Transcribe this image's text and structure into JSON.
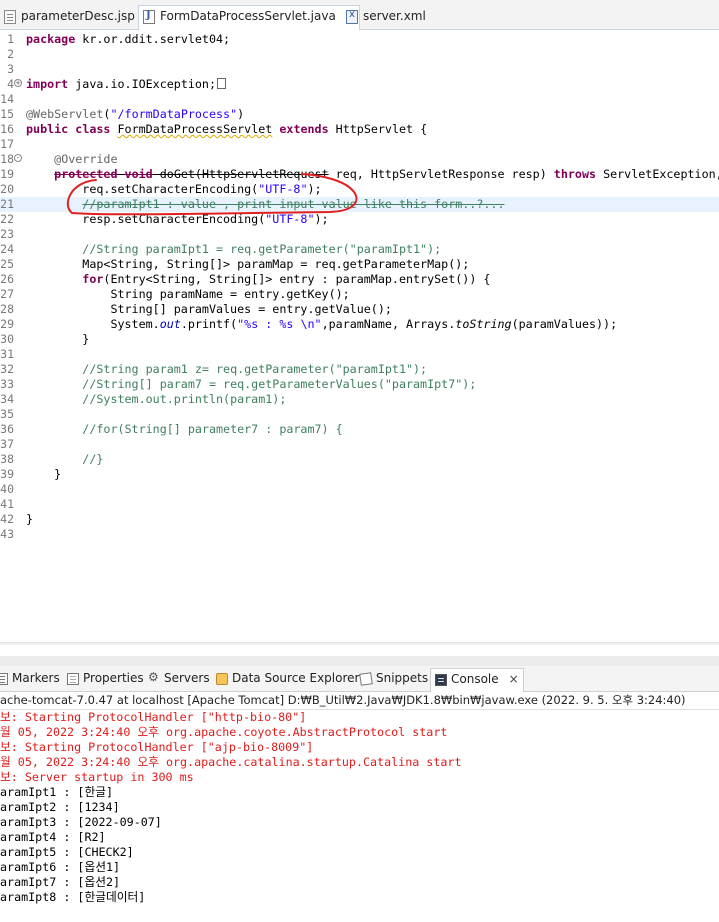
{
  "editor_tabs": [
    {
      "label": "parameterDesc.jsp",
      "icon": "jsp-file-icon",
      "active": false
    },
    {
      "label": "FormDataProcessServlet.java",
      "icon": "java-file-icon",
      "active": true,
      "close": "×"
    },
    {
      "label": "server.xml",
      "icon": "xml-file-icon",
      "active": false
    }
  ],
  "code": {
    "lines": [
      {
        "n": "1",
        "spans": [
          {
            "t": "package",
            "c": "kw"
          },
          {
            "t": " kr.or.ddit.servlet04;"
          }
        ]
      },
      {
        "n": "2",
        "spans": []
      },
      {
        "n": "3",
        "spans": []
      },
      {
        "n": "4",
        "fold": "+",
        "spans": [
          {
            "t": "import",
            "c": "kw"
          },
          {
            "t": " java.io.IOException;"
          }
        ],
        "collapsed": true
      },
      {
        "n": "14",
        "spans": []
      },
      {
        "n": "15",
        "spans": [
          {
            "t": "@WebServlet",
            "c": "ann"
          },
          {
            "t": "("
          },
          {
            "t": "\"/formDataProcess\"",
            "c": "str"
          },
          {
            "t": ")"
          }
        ]
      },
      {
        "n": "16",
        "spans": [
          {
            "t": "public",
            "c": "kw"
          },
          {
            "t": " "
          },
          {
            "t": "class",
            "c": "kw"
          },
          {
            "t": " "
          },
          {
            "t": "FormDataProcessServlet",
            "c": "warn"
          },
          {
            "t": " "
          },
          {
            "t": "extends",
            "c": "kw"
          },
          {
            "t": " HttpServlet {"
          }
        ]
      },
      {
        "n": "17",
        "spans": []
      },
      {
        "n": "18",
        "fold": "-",
        "spans": [
          {
            "t": "    "
          },
          {
            "t": "@Override",
            "c": "ann"
          }
        ]
      },
      {
        "n": "19",
        "spans": [
          {
            "t": "    "
          },
          {
            "t": "protected",
            "c": "kw strike"
          },
          {
            "t": " ",
            "c": "strike"
          },
          {
            "t": "void",
            "c": "kw strike"
          },
          {
            "t": " doGet(HttpServletRequest",
            "c": "strike"
          },
          {
            "t": " req, HttpServletResponse resp) "
          },
          {
            "t": "throws",
            "c": "kw"
          },
          {
            "t": " ServletException, IOExceptio"
          }
        ]
      },
      {
        "n": "20",
        "spans": [
          {
            "t": "        req.setCharacterEncoding("
          },
          {
            "t": "\"UTF-8\"",
            "c": "str"
          },
          {
            "t": ");"
          }
        ]
      },
      {
        "n": "21",
        "current": true,
        "spans": [
          {
            "t": "        "
          },
          {
            "t": "//paramIpt1 : value , print input value like this form..?...",
            "c": "cmt strike"
          }
        ]
      },
      {
        "n": "22",
        "spans": [
          {
            "t": "        resp.setCharacterEncoding("
          },
          {
            "t": "\"UTF-8\"",
            "c": "str"
          },
          {
            "t": ");"
          }
        ]
      },
      {
        "n": "23",
        "spans": []
      },
      {
        "n": "24",
        "spans": [
          {
            "t": "        "
          },
          {
            "t": "//String paramIpt1 = req.getParameter(\"paramIpt1\");",
            "c": "cmt"
          }
        ]
      },
      {
        "n": "25",
        "spans": [
          {
            "t": "        Map<String, String[]> paramMap = req.getParameterMap();"
          }
        ]
      },
      {
        "n": "26",
        "spans": [
          {
            "t": "        "
          },
          {
            "t": "for",
            "c": "kw"
          },
          {
            "t": "(Entry<String, String[]> entry : paramMap.entrySet()) {"
          }
        ]
      },
      {
        "n": "27",
        "spans": [
          {
            "t": "            String paramName = entry.getKey();"
          }
        ]
      },
      {
        "n": "28",
        "spans": [
          {
            "t": "            String[] paramValues = entry.getValue();"
          }
        ]
      },
      {
        "n": "29",
        "spans": [
          {
            "t": "            System."
          },
          {
            "t": "out",
            "c": "sfld"
          },
          {
            "t": ".printf("
          },
          {
            "t": "\"%s : %s \\n\"",
            "c": "str"
          },
          {
            "t": ",paramName, Arrays."
          },
          {
            "t": "toString",
            "c": "meth-i"
          },
          {
            "t": "(paramValues));"
          }
        ]
      },
      {
        "n": "30",
        "spans": [
          {
            "t": "        }"
          }
        ]
      },
      {
        "n": "31",
        "spans": []
      },
      {
        "n": "32",
        "spans": [
          {
            "t": "        "
          },
          {
            "t": "//String param1 z= req.getParameter(\"paramIpt1\");",
            "c": "cmt"
          }
        ]
      },
      {
        "n": "33",
        "spans": [
          {
            "t": "        "
          },
          {
            "t": "//String[] param7 = req.getParameterValues(\"paramIpt7\");",
            "c": "cmt"
          }
        ]
      },
      {
        "n": "34",
        "spans": [
          {
            "t": "        "
          },
          {
            "t": "//System.out.println(param1);",
            "c": "cmt"
          }
        ]
      },
      {
        "n": "35",
        "spans": []
      },
      {
        "n": "36",
        "spans": [
          {
            "t": "        "
          },
          {
            "t": "//for(String[] parameter7 : param7) {",
            "c": "cmt"
          }
        ]
      },
      {
        "n": "37",
        "spans": []
      },
      {
        "n": "38",
        "spans": [
          {
            "t": "        "
          },
          {
            "t": "//}",
            "c": "cmt"
          }
        ]
      },
      {
        "n": "39",
        "spans": [
          {
            "t": "    }"
          }
        ]
      },
      {
        "n": "40",
        "spans": []
      },
      {
        "n": "41",
        "spans": []
      },
      {
        "n": "42",
        "spans": [
          {
            "t": "}"
          }
        ]
      },
      {
        "n": "43",
        "spans": []
      }
    ]
  },
  "scrollbar": {
    "left_arrow": "<"
  },
  "panel_tabs": [
    {
      "label": "Markers",
      "icon": "markers-icon"
    },
    {
      "label": "Properties",
      "icon": "properties-icon"
    },
    {
      "label": "Servers",
      "icon": "servers-icon"
    },
    {
      "label": "Data Source Explorer",
      "icon": "data-source-explorer-icon"
    },
    {
      "label": "Snippets",
      "icon": "snippets-icon"
    },
    {
      "label": "Console",
      "icon": "console-icon",
      "active": true,
      "close": "×"
    }
  ],
  "console": {
    "header": "ache-tomcat-7.0.47 at localhost [Apache Tomcat] D:₩B_Util₩2.Java₩JDK1.8₩bin₩javaw.exe  (2022. 9. 5. 오후 3:24:40)",
    "lines": [
      {
        "text": "보: Starting ProtocolHandler [\"http-bio-80\"]",
        "kind": "err"
      },
      {
        "text": "월 05, 2022 3:24:40 오후 org.apache.coyote.AbstractProtocol start",
        "kind": "err"
      },
      {
        "text": "보: Starting ProtocolHandler [\"ajp-bio-8009\"]",
        "kind": "err"
      },
      {
        "text": "월 05, 2022 3:24:40 오후 org.apache.catalina.startup.Catalina start",
        "kind": "err"
      },
      {
        "text": "보: Server startup in 300 ms",
        "kind": "err"
      },
      {
        "text": "aramIpt1 : [한글]",
        "kind": "out"
      },
      {
        "text": "aramIpt2 : [1234]",
        "kind": "out"
      },
      {
        "text": "aramIpt3 : [2022-09-07]",
        "kind": "out"
      },
      {
        "text": "aramIpt4 : [R2]",
        "kind": "out"
      },
      {
        "text": "aramIpt5 : [CHECK2]",
        "kind": "out"
      },
      {
        "text": "aramIpt6 : [옵션1]",
        "kind": "out"
      },
      {
        "text": "aramIpt7 : [옵션2]",
        "kind": "out"
      },
      {
        "text": "aramIpt8 : [한글데이터]",
        "kind": "out"
      }
    ]
  },
  "colors": {
    "keyword": "#7f0055",
    "string": "#2a00ff",
    "comment": "#3f7f5f",
    "console_error": "#e01b1b",
    "annotation_mark": "#e02020"
  }
}
